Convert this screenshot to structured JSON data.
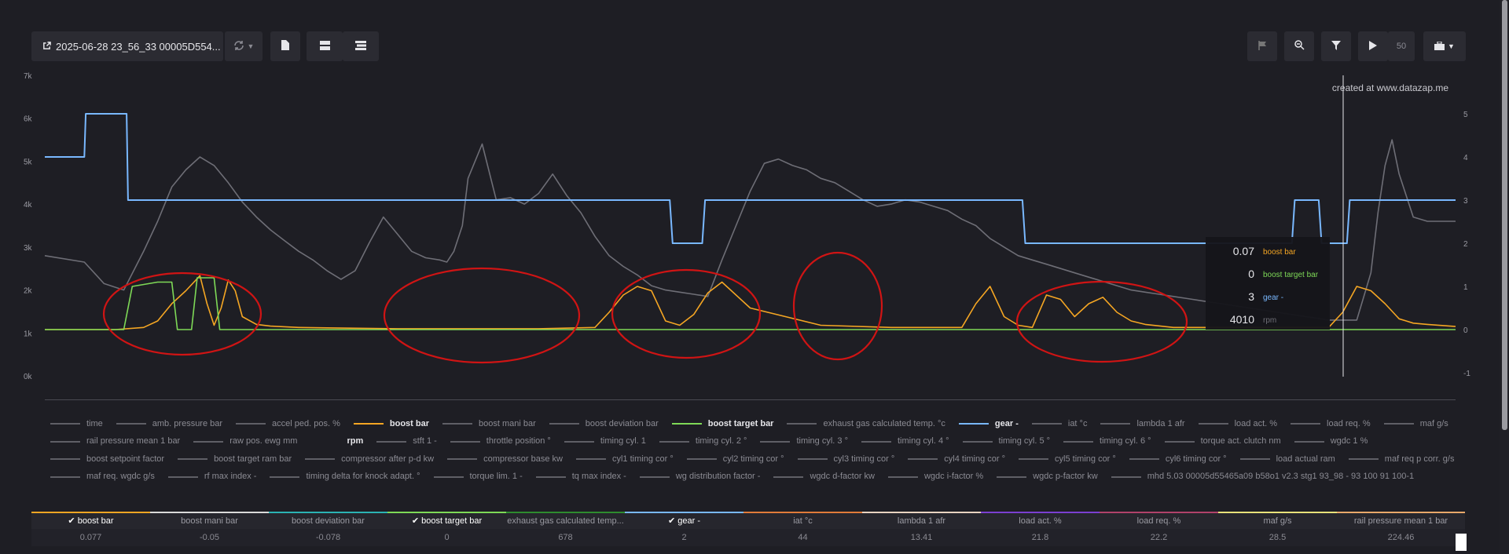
{
  "toolbar": {
    "file_label": "2025-06-28 23_56_33 00005D554...",
    "speed": "50"
  },
  "watermark": "created at www.datazap.me",
  "tooltip": [
    {
      "value": "0.07",
      "name": "boost bar",
      "color": "#f5a623"
    },
    {
      "value": "0",
      "name": "boost target bar",
      "color": "#7ed957"
    },
    {
      "value": "3",
      "name": "gear -",
      "color": "#79b8ff"
    },
    {
      "value": "4010",
      "name": "rpm",
      "color": "#6e6e76"
    }
  ],
  "legend": [
    {
      "name": "time",
      "on": false,
      "color": ""
    },
    {
      "name": "amb. pressure bar",
      "on": false,
      "color": ""
    },
    {
      "name": "accel ped. pos. %",
      "on": false,
      "color": ""
    },
    {
      "name": "boost bar",
      "on": true,
      "color": "#f5a623"
    },
    {
      "name": "boost mani bar",
      "on": false,
      "color": ""
    },
    {
      "name": "boost deviation bar",
      "on": false,
      "color": ""
    },
    {
      "name": "boost target bar",
      "on": true,
      "color": "#7ed957"
    },
    {
      "name": "exhaust gas calculated temp. °c",
      "on": false,
      "color": ""
    },
    {
      "name": "gear -",
      "on": true,
      "color": "#79b8ff"
    },
    {
      "name": "iat °c",
      "on": false,
      "color": ""
    },
    {
      "name": "lambda 1 afr",
      "on": false,
      "color": ""
    },
    {
      "name": "load act. %",
      "on": false,
      "color": ""
    },
    {
      "name": "load req. %",
      "on": false,
      "color": ""
    },
    {
      "name": "maf g/s",
      "on": false,
      "color": ""
    },
    {
      "name": "rail pressure mean 1 bar",
      "on": false,
      "color": ""
    },
    {
      "name": "raw pos. ewg mm",
      "on": false,
      "color": ""
    },
    {
      "name": "rpm",
      "on": true,
      "color": "#1e1e24"
    },
    {
      "name": "stft 1 -",
      "on": false,
      "color": ""
    },
    {
      "name": "throttle position °",
      "on": false,
      "color": ""
    },
    {
      "name": "timing cyl. 1",
      "on": false,
      "color": ""
    },
    {
      "name": "timing cyl. 2 °",
      "on": false,
      "color": ""
    },
    {
      "name": "timing cyl. 3 °",
      "on": false,
      "color": ""
    },
    {
      "name": "timing cyl. 4 °",
      "on": false,
      "color": ""
    },
    {
      "name": "timing cyl. 5 °",
      "on": false,
      "color": ""
    },
    {
      "name": "timing cyl. 6 °",
      "on": false,
      "color": ""
    },
    {
      "name": "torque act. clutch nm",
      "on": false,
      "color": ""
    },
    {
      "name": "wgdc 1 %",
      "on": false,
      "color": ""
    },
    {
      "name": "boost setpoint factor",
      "on": false,
      "color": ""
    },
    {
      "name": "boost target ram bar",
      "on": false,
      "color": ""
    },
    {
      "name": "compressor after p-d kw",
      "on": false,
      "color": ""
    },
    {
      "name": "compressor base kw",
      "on": false,
      "color": ""
    },
    {
      "name": "cyl1 timing cor °",
      "on": false,
      "color": ""
    },
    {
      "name": "cyl2 timing cor °",
      "on": false,
      "color": ""
    },
    {
      "name": "cyl3 timing cor °",
      "on": false,
      "color": ""
    },
    {
      "name": "cyl4 timing cor °",
      "on": false,
      "color": ""
    },
    {
      "name": "cyl5 timing cor °",
      "on": false,
      "color": ""
    },
    {
      "name": "cyl6 timing cor °",
      "on": false,
      "color": ""
    },
    {
      "name": "load actual ram",
      "on": false,
      "color": ""
    },
    {
      "name": "maf req p corr. g/s",
      "on": false,
      "color": ""
    },
    {
      "name": "maf req. wgdc g/s",
      "on": false,
      "color": ""
    },
    {
      "name": "rf max index -",
      "on": false,
      "color": ""
    },
    {
      "name": "timing delta for knock adapt. °",
      "on": false,
      "color": ""
    },
    {
      "name": "torque lim. 1 -",
      "on": false,
      "color": ""
    },
    {
      "name": "tq max index -",
      "on": false,
      "color": ""
    },
    {
      "name": "wg distribution factor -",
      "on": false,
      "color": ""
    },
    {
      "name": "wgdc d-factor kw",
      "on": false,
      "color": ""
    },
    {
      "name": "wgdc i-factor %",
      "on": false,
      "color": ""
    },
    {
      "name": "wgdc p-factor kw",
      "on": false,
      "color": ""
    },
    {
      "name": "mhd 5.03 00005d55465a09 b58o1 v2.3 stg1 93_98 - 93 100 91 100-1",
      "on": false,
      "color": ""
    }
  ],
  "table": [
    {
      "name": "boost bar",
      "value": "0.077",
      "checked": true,
      "color": "#f5a623"
    },
    {
      "name": "boost mani bar",
      "value": "-0.05",
      "checked": false,
      "color": "#d9d9d9"
    },
    {
      "name": "boost deviation bar",
      "value": "-0.078",
      "checked": false,
      "color": "#2bb3b3"
    },
    {
      "name": "boost target bar",
      "value": "0",
      "checked": true,
      "color": "#7ed957"
    },
    {
      "name": "exhaust gas calculated temp...",
      "value": "678",
      "checked": false,
      "color": "#2e8b2e"
    },
    {
      "name": "gear -",
      "value": "2",
      "checked": true,
      "color": "#79b8ff"
    },
    {
      "name": "iat °c",
      "value": "44",
      "checked": false,
      "color": "#e07b39"
    },
    {
      "name": "lambda 1 afr",
      "value": "13.41",
      "checked": false,
      "color": "#e8d3c0"
    },
    {
      "name": "load act. %",
      "value": "21.8",
      "checked": false,
      "color": "#7b3fd1"
    },
    {
      "name": "load req. %",
      "value": "22.2",
      "checked": false,
      "color": "#b0426a"
    },
    {
      "name": "maf g/s",
      "value": "28.5",
      "checked": false,
      "color": "#e8e27a"
    },
    {
      "name": "rail pressure mean 1 bar",
      "value": "224.46",
      "checked": false,
      "color": "#e8a86a"
    }
  ],
  "chart_data": {
    "type": "line",
    "left_axis": {
      "ticks": [
        "0k",
        "1k",
        "2k",
        "3k",
        "4k",
        "5k",
        "6k",
        "7k"
      ],
      "range": [
        0,
        7000
      ]
    },
    "right_axis": {
      "ticks": [
        "-1",
        "0",
        "1",
        "2",
        "3",
        "4",
        "5"
      ],
      "range": [
        -1,
        5
      ]
    },
    "series": [
      {
        "name": "rpm",
        "axis": "left",
        "color": "#6e6e76",
        "x": [
          0,
          2.8,
          4.2,
          5.6,
          7,
          8,
          9,
          10,
          11,
          12,
          13,
          14,
          15,
          16,
          17,
          18,
          19,
          20,
          21,
          22,
          23,
          24,
          25,
          26,
          27,
          28,
          28.5,
          29,
          29.6,
          30,
          31,
          32,
          33,
          34,
          35,
          36,
          37,
          38,
          39,
          40,
          41,
          42,
          43,
          44,
          45,
          46,
          47,
          48,
          49,
          50,
          51,
          52,
          53,
          54,
          55,
          56,
          57,
          58,
          59,
          60,
          61,
          62,
          63,
          64,
          65,
          66,
          67,
          68,
          69,
          70,
          71,
          72,
          73,
          74,
          75,
          76,
          77,
          78,
          79,
          80,
          81,
          82,
          83,
          84,
          85,
          86,
          87,
          88,
          89,
          90,
          91,
          92,
          93,
          94,
          94.5,
          95,
          95.5,
          96,
          97,
          98,
          99,
          100
        ],
        "y": [
          2800,
          2650,
          2150,
          2000,
          2900,
          3600,
          4400,
          4800,
          5100,
          4900,
          4500,
          4050,
          3700,
          3400,
          3150,
          2900,
          2700,
          2450,
          2250,
          2450,
          3100,
          3700,
          3300,
          2900,
          2750,
          2700,
          2650,
          2900,
          3500,
          4600,
          5400,
          4100,
          4150,
          4000,
          4250,
          4700,
          4200,
          3800,
          3250,
          2800,
          2550,
          2350,
          2100,
          2000,
          1950,
          1900,
          1850,
          2700,
          3500,
          4300,
          4950,
          5050,
          4900,
          4800,
          4600,
          4500,
          4300,
          4100,
          3950,
          4000,
          4100,
          4050,
          3950,
          3850,
          3650,
          3500,
          3200,
          3000,
          2800,
          2700,
          2600,
          2500,
          2400,
          2300,
          2200,
          2100,
          2000,
          1950,
          1900,
          1850,
          1800,
          1750,
          1700,
          1650,
          1600,
          1550,
          1500,
          1450,
          1400,
          1350,
          1300,
          1300,
          1300,
          2400,
          3800,
          4900,
          5500,
          4700,
          3700,
          3600,
          3600,
          3600
        ]
      },
      {
        "name": "gear -",
        "axis": "right",
        "color": "#79b8ff",
        "x": [
          0,
          2.8,
          2.9,
          5.8,
          5.9,
          44.3,
          44.5,
          46.6,
          46.8,
          69.3,
          69.5,
          88.4,
          88.6,
          90.3,
          90.5,
          92.3,
          92.5,
          100
        ],
        "y": [
          4,
          4,
          5,
          5,
          3,
          3,
          2,
          2,
          3,
          3,
          2,
          2,
          3,
          3,
          2,
          2,
          3,
          3
        ]
      },
      {
        "name": "boost bar",
        "axis": "right",
        "color": "#f5a623",
        "x": [
          0,
          5,
          7,
          8,
          9,
          10,
          11,
          11.5,
          12,
          12.5,
          13,
          13.5,
          14,
          15,
          16,
          18,
          20,
          25,
          30,
          35,
          39,
          40,
          41,
          42,
          43,
          44,
          45,
          46,
          47,
          48,
          50,
          55,
          60,
          65,
          66,
          67,
          68,
          69,
          70,
          71,
          72,
          73,
          74,
          75,
          76,
          77,
          78,
          80,
          85,
          88,
          89,
          90,
          91,
          92,
          93,
          94,
          95,
          96,
          96.5,
          97,
          98,
          100
        ],
        "y": [
          0,
          0,
          0.05,
          0.2,
          0.6,
          0.9,
          1.25,
          0.6,
          0.1,
          0.5,
          1.15,
          0.9,
          0.3,
          0.12,
          0.08,
          0.05,
          0.04,
          0.02,
          0.02,
          0.02,
          0.05,
          0.4,
          0.8,
          1.0,
          0.9,
          0.2,
          0.1,
          0.35,
          0.85,
          1.1,
          0.5,
          0.1,
          0.05,
          0.05,
          0.6,
          1.0,
          0.3,
          0.1,
          0.05,
          0.8,
          0.7,
          0.3,
          0.6,
          0.75,
          0.4,
          0.2,
          0.12,
          0.05,
          0.05,
          0.05,
          0.05,
          0.05,
          0.05,
          0.4,
          1.0,
          0.9,
          0.6,
          0.25,
          0.2,
          0.15,
          0.12,
          0.07
        ]
      },
      {
        "name": "boost target bar",
        "axis": "right",
        "color": "#7ed957",
        "x": [
          0,
          5.6,
          6.2,
          8,
          9,
          9.4,
          10.4,
          10.8,
          12,
          12.4,
          13.4,
          14,
          100
        ],
        "y": [
          0,
          0,
          1,
          1.1,
          1.1,
          0,
          0,
          1.2,
          1.2,
          0,
          0,
          0,
          0
        ]
      }
    ],
    "annotations": [
      "red ellipses highlighting boost events"
    ]
  }
}
